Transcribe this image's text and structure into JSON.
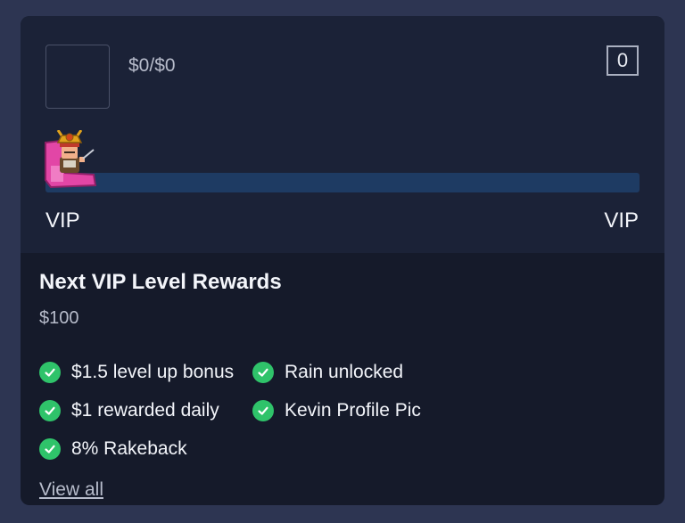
{
  "header": {
    "wager_text": "$0/$0",
    "level_badge": "0",
    "current_tier": "VIP",
    "next_tier": "VIP",
    "progress_fraction": 0
  },
  "rewards": {
    "title": "Next VIP Level Rewards",
    "amount": "$100",
    "items": [
      {
        "label": "$1.5 level up bonus"
      },
      {
        "label": "Rain unlocked"
      },
      {
        "label": "$1 rewarded daily"
      },
      {
        "label": "Kevin Profile Pic"
      },
      {
        "label": "8% Rakeback"
      }
    ],
    "view_all": "View all"
  },
  "icons": {
    "check": "check-circle-icon",
    "mascot": "samurai-mascot-icon"
  },
  "colors": {
    "background": "#2d3552",
    "card_top": "#1b2237",
    "card_bottom": "#151a2a",
    "progress_track": "#1e3b63",
    "check_green": "#2fc36a",
    "mascot_pink": "#e246a6"
  }
}
